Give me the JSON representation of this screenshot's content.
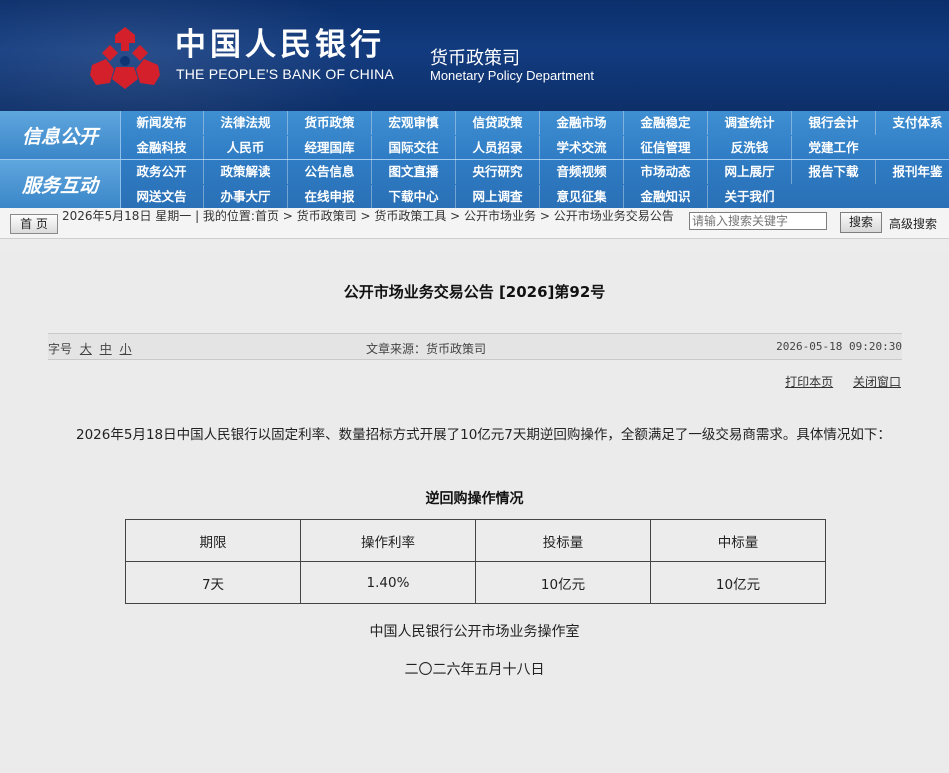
{
  "header": {
    "bank_name_cn": "中国人民银行",
    "bank_name_en": "THE PEOPLE'S BANK OF CHINA",
    "dept_cn": "货币政策司",
    "dept_en": "Monetary Policy Department",
    "logo_color": "#d4202a"
  },
  "nav": {
    "section1": "信息公开",
    "section2": "服务互动",
    "rows": [
      [
        "新闻发布",
        "法律法规",
        "货币政策",
        "宏观审慎",
        "信贷政策",
        "金融市场",
        "金融稳定",
        "调查统计",
        "银行会计",
        "支付体系"
      ],
      [
        "金融科技",
        "人民币",
        "经理国库",
        "国际交往",
        "人员招录",
        "学术交流",
        "征信管理",
        "反洗钱",
        "党建工作"
      ],
      [
        "政务公开",
        "政策解读",
        "公告信息",
        "图文直播",
        "央行研究",
        "音频视频",
        "市场动态",
        "网上展厅",
        "报告下载",
        "报刊年鉴"
      ],
      [
        "网送文告",
        "办事大厅",
        "在线申报",
        "下载中心",
        "网上调查",
        "意见征集",
        "金融知识",
        "关于我们"
      ]
    ]
  },
  "breadcrumb": {
    "home_label": "首 页",
    "text": "2026年5月18日 星期一 | 我的位置:首页  >  货币政策司  >  货币政策工具  >  公开市场业务  >  公开市场业务交易公告",
    "search_placeholder": "请输入搜索关键字",
    "search_button": "搜索",
    "advanced_search": "高级搜索"
  },
  "article": {
    "title": "公开市场业务交易公告 [2026]第92号",
    "font_size_label": "字号",
    "size_large": "大",
    "size_medium": "中",
    "size_small": "小",
    "source": "文章来源：货币政策司",
    "datetime": "2026-05-18 09:20:30",
    "print_label": "打印本页",
    "close_label": "关闭窗口",
    "paragraph": "2026年5月18日中国人民银行以固定利率、数量招标方式开展了10亿元7天期逆回购操作，全额满足了一级交易商需求。具体情况如下：",
    "table_title": "逆回购操作情况",
    "table_headers": [
      "期限",
      "操作利率",
      "投标量",
      "中标量"
    ],
    "table_row": [
      "7天",
      "1.40%",
      "10亿元",
      "10亿元"
    ],
    "signature": "中国人民银行公开市场业务操作室",
    "sign_date": "二〇二六年五月十八日"
  }
}
